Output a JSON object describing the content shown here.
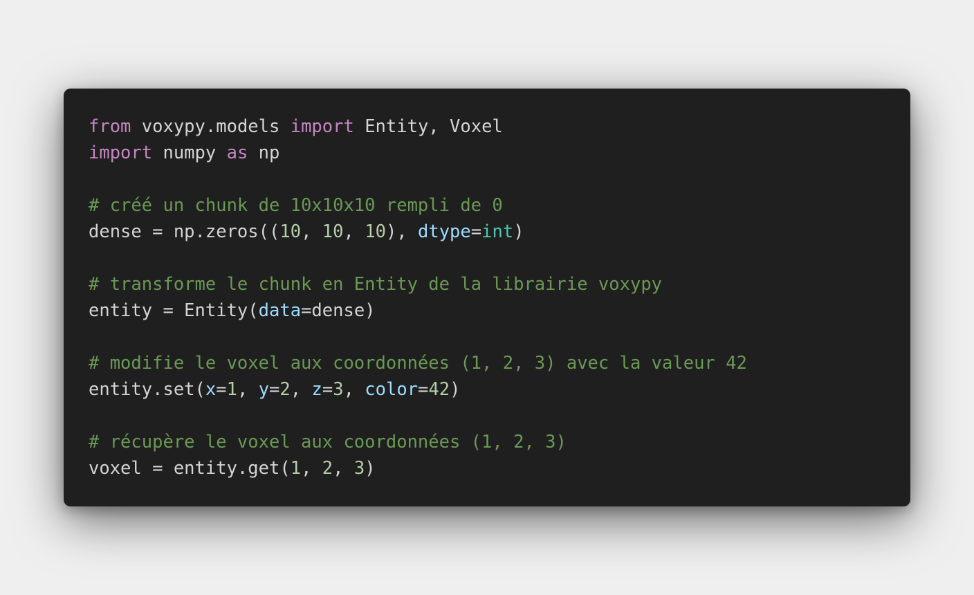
{
  "colors": {
    "background": "#efefef",
    "card": "#1f1f1f",
    "keyword": "#c586c0",
    "plain": "#d4d4d4",
    "comment": "#6a9955",
    "number": "#b5cea8",
    "param": "#9cdcfe",
    "type": "#4ec9b0"
  },
  "code_lines": [
    [
      {
        "t": "keyword",
        "v": "from"
      },
      {
        "t": "plain",
        "v": " voxypy.models "
      },
      {
        "t": "keyword",
        "v": "import"
      },
      {
        "t": "plain",
        "v": " Entity, Voxel"
      }
    ],
    [
      {
        "t": "keyword",
        "v": "import"
      },
      {
        "t": "plain",
        "v": " numpy "
      },
      {
        "t": "keyword",
        "v": "as"
      },
      {
        "t": "plain",
        "v": " np"
      }
    ],
    [],
    [
      {
        "t": "comment",
        "v": "# créé un chunk de 10x10x10 rempli de 0"
      }
    ],
    [
      {
        "t": "plain",
        "v": "dense = np.zeros(("
      },
      {
        "t": "number",
        "v": "10"
      },
      {
        "t": "plain",
        "v": ", "
      },
      {
        "t": "number",
        "v": "10"
      },
      {
        "t": "plain",
        "v": ", "
      },
      {
        "t": "number",
        "v": "10"
      },
      {
        "t": "plain",
        "v": "), "
      },
      {
        "t": "param",
        "v": "dtype"
      },
      {
        "t": "plain",
        "v": "="
      },
      {
        "t": "type",
        "v": "int"
      },
      {
        "t": "plain",
        "v": ")"
      }
    ],
    [],
    [
      {
        "t": "comment",
        "v": "# transforme le chunk en Entity de la librairie voxypy"
      }
    ],
    [
      {
        "t": "plain",
        "v": "entity = Entity("
      },
      {
        "t": "param",
        "v": "data"
      },
      {
        "t": "plain",
        "v": "=dense)"
      }
    ],
    [],
    [
      {
        "t": "comment",
        "v": "# modifie le voxel aux coordonnées (1, 2, 3) avec la valeur 42"
      }
    ],
    [
      {
        "t": "plain",
        "v": "entity.set("
      },
      {
        "t": "param",
        "v": "x"
      },
      {
        "t": "plain",
        "v": "="
      },
      {
        "t": "number",
        "v": "1"
      },
      {
        "t": "plain",
        "v": ", "
      },
      {
        "t": "param",
        "v": "y"
      },
      {
        "t": "plain",
        "v": "="
      },
      {
        "t": "number",
        "v": "2"
      },
      {
        "t": "plain",
        "v": ", "
      },
      {
        "t": "param",
        "v": "z"
      },
      {
        "t": "plain",
        "v": "="
      },
      {
        "t": "number",
        "v": "3"
      },
      {
        "t": "plain",
        "v": ", "
      },
      {
        "t": "param",
        "v": "color"
      },
      {
        "t": "plain",
        "v": "="
      },
      {
        "t": "number",
        "v": "42"
      },
      {
        "t": "plain",
        "v": ")"
      }
    ],
    [],
    [
      {
        "t": "comment",
        "v": "# récupère le voxel aux coordonnées (1, 2, 3)"
      }
    ],
    [
      {
        "t": "plain",
        "v": "voxel = entity.get("
      },
      {
        "t": "number",
        "v": "1"
      },
      {
        "t": "plain",
        "v": ", "
      },
      {
        "t": "number",
        "v": "2"
      },
      {
        "t": "plain",
        "v": ", "
      },
      {
        "t": "number",
        "v": "3"
      },
      {
        "t": "plain",
        "v": ")"
      }
    ]
  ]
}
